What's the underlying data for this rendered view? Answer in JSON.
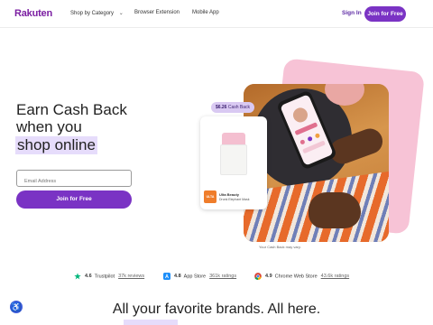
{
  "header": {
    "logo": "Rakuten",
    "nav": [
      {
        "label": "Shop by Category",
        "chevron": "⌄"
      },
      {
        "label": "Browser Extension"
      },
      {
        "label": "Mobile App"
      }
    ],
    "sign_in": "Sign In",
    "join": "Join for Free"
  },
  "hero": {
    "line1": "Earn Cash Back",
    "line2": "when you",
    "line3": "shop online",
    "email_placeholder": "Email Address",
    "join_button": "Join for Free",
    "cashback_pill_amount": "$6.26",
    "cashback_pill_text": "Cash Back",
    "product": {
      "logo_text": "ULTA",
      "brand": "Ulta Beauty",
      "item": "Drunk Elephant Mask"
    },
    "caption": "Your Cash Back may vary."
  },
  "ratings": [
    {
      "score": "4.6",
      "source": "Trustpilot",
      "count": "37k reviews",
      "icon": "trustpilot-star-icon"
    },
    {
      "score": "4.8",
      "source": "App Store",
      "count": "361k ratings",
      "icon": "app-store-icon"
    },
    {
      "score": "4.9",
      "source": "Chrome Web Store",
      "count": "43.6k ratings",
      "icon": "chrome-store-icon"
    }
  ],
  "bottom": {
    "title": "All your favorite brands. All here."
  },
  "colors": {
    "brand_purple": "#7a33c4",
    "highlight": "#e6dcfb",
    "pink_card": "#f7c3d6"
  }
}
